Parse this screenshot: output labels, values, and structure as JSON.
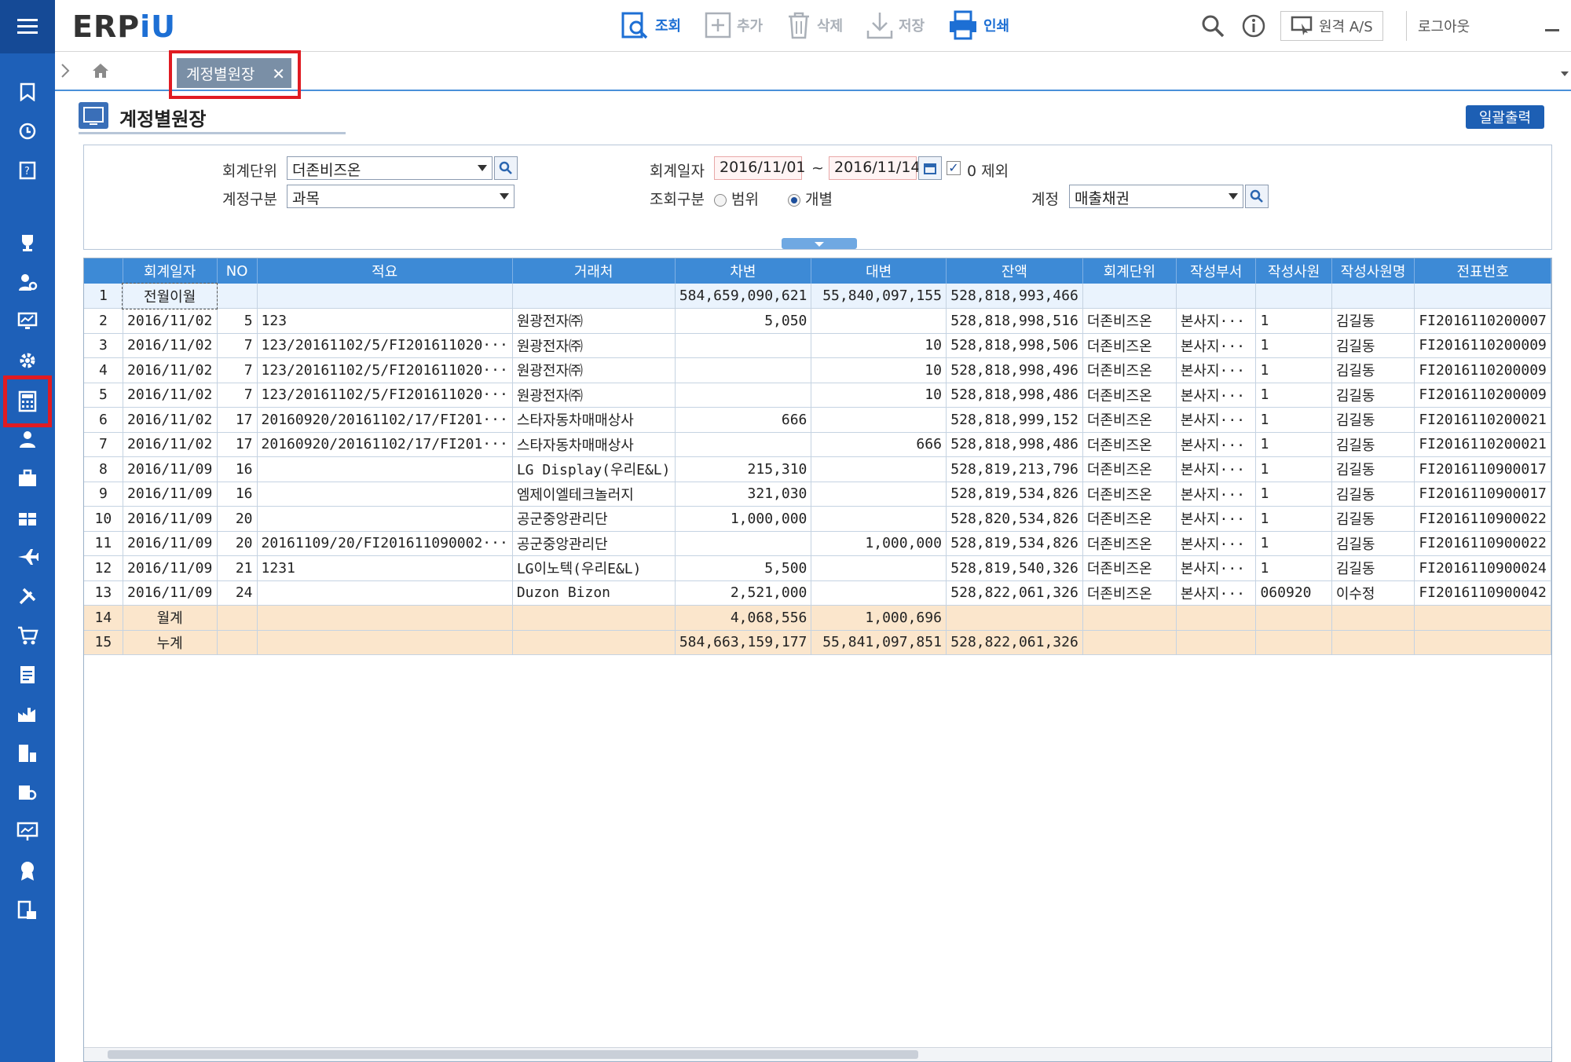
{
  "app": {
    "logo_a": "ERP",
    "logo_b": "iU"
  },
  "toolbar": {
    "search": "조회",
    "add": "추가",
    "delete": "삭제",
    "save": "저장",
    "print": "인쇄",
    "remote": "원격 A/S",
    "logout": "로그아웃"
  },
  "tabs": [
    {
      "label": "계정별원장"
    }
  ],
  "page": {
    "title": "계정별원장",
    "print_all": "일괄출력"
  },
  "filters": {
    "unit_label": "회계단위",
    "unit_value": "더존비즈온",
    "acct_type_label": "계정구분",
    "acct_type_value": "과목",
    "date_label": "회계일자",
    "date_from": "2016/11/01",
    "date_sep": "~",
    "date_to": "2016/11/14",
    "zero_exclude": "0 제외",
    "query_type_label": "조회구분",
    "query_range": "범위",
    "query_single": "개별",
    "account_label": "계정",
    "account_value": "매출채권"
  },
  "grid": {
    "headers": [
      "",
      "회계일자",
      "NO",
      "적요",
      "거래처",
      "차변",
      "대변",
      "잔액",
      "회계단위",
      "작성부서",
      "작성사원",
      "작성사원명",
      "전표번호"
    ],
    "rows": [
      [
        "1",
        "전월이월",
        "",
        "",
        "",
        "584,659,090,621",
        "55,840,097,155",
        "528,818,993,466",
        "",
        "",
        "",
        "",
        ""
      ],
      [
        "2",
        "2016/11/02",
        "5",
        "123",
        "원광전자㈜",
        "5,050",
        "",
        "528,818,998,516",
        "더존비즈온",
        "본사지···",
        "1",
        "김길동",
        "FI2016110200007"
      ],
      [
        "3",
        "2016/11/02",
        "7",
        "123/20161102/5/FI201611020···",
        "원광전자㈜",
        "",
        "10",
        "528,818,998,506",
        "더존비즈온",
        "본사지···",
        "1",
        "김길동",
        "FI2016110200009"
      ],
      [
        "4",
        "2016/11/02",
        "7",
        "123/20161102/5/FI201611020···",
        "원광전자㈜",
        "",
        "10",
        "528,818,998,496",
        "더존비즈온",
        "본사지···",
        "1",
        "김길동",
        "FI2016110200009"
      ],
      [
        "5",
        "2016/11/02",
        "7",
        "123/20161102/5/FI201611020···",
        "원광전자㈜",
        "",
        "10",
        "528,818,998,486",
        "더존비즈온",
        "본사지···",
        "1",
        "김길동",
        "FI2016110200009"
      ],
      [
        "6",
        "2016/11/02",
        "17",
        "20160920/20161102/17/FI201···",
        "스타자동차매매상사",
        "666",
        "",
        "528,818,999,152",
        "더존비즈온",
        "본사지···",
        "1",
        "김길동",
        "FI2016110200021"
      ],
      [
        "7",
        "2016/11/02",
        "17",
        "20160920/20161102/17/FI201···",
        "스타자동차매매상사",
        "",
        "666",
        "528,818,998,486",
        "더존비즈온",
        "본사지···",
        "1",
        "김길동",
        "FI2016110200021"
      ],
      [
        "8",
        "2016/11/09",
        "16",
        "",
        "LG Display(우리E&L)",
        "215,310",
        "",
        "528,819,213,796",
        "더존비즈온",
        "본사지···",
        "1",
        "김길동",
        "FI2016110900017"
      ],
      [
        "9",
        "2016/11/09",
        "16",
        "",
        "엠제이엘테크놀러지",
        "321,030",
        "",
        "528,819,534,826",
        "더존비즈온",
        "본사지···",
        "1",
        "김길동",
        "FI2016110900017"
      ],
      [
        "10",
        "2016/11/09",
        "20",
        "",
        "공군중앙관리단",
        "1,000,000",
        "",
        "528,820,534,826",
        "더존비즈온",
        "본사지···",
        "1",
        "김길동",
        "FI2016110900022"
      ],
      [
        "11",
        "2016/11/09",
        "20",
        "20161109/20/FI201611090002···",
        "공군중앙관리단",
        "",
        "1,000,000",
        "528,819,534,826",
        "더존비즈온",
        "본사지···",
        "1",
        "김길동",
        "FI2016110900022"
      ],
      [
        "12",
        "2016/11/09",
        "21",
        "1231",
        "LG이노텍(우리E&L)",
        "5,500",
        "",
        "528,819,540,326",
        "더존비즈온",
        "본사지···",
        "1",
        "김길동",
        "FI2016110900024"
      ],
      [
        "13",
        "2016/11/09",
        "24",
        "",
        "Duzon Bizon",
        "2,521,000",
        "",
        "528,822,061,326",
        "더존비즈온",
        "본사지···",
        "060920",
        "이수정",
        "FI2016110900042"
      ],
      [
        "14",
        "월계",
        "",
        "",
        "",
        "4,068,556",
        "1,000,696",
        "",
        "",
        "",
        "",
        "",
        ""
      ],
      [
        "15",
        "누계",
        "",
        "",
        "",
        "584,663,159,177",
        "55,841,097,851",
        "528,822,061,326",
        "",
        "",
        "",
        "",
        ""
      ]
    ]
  }
}
